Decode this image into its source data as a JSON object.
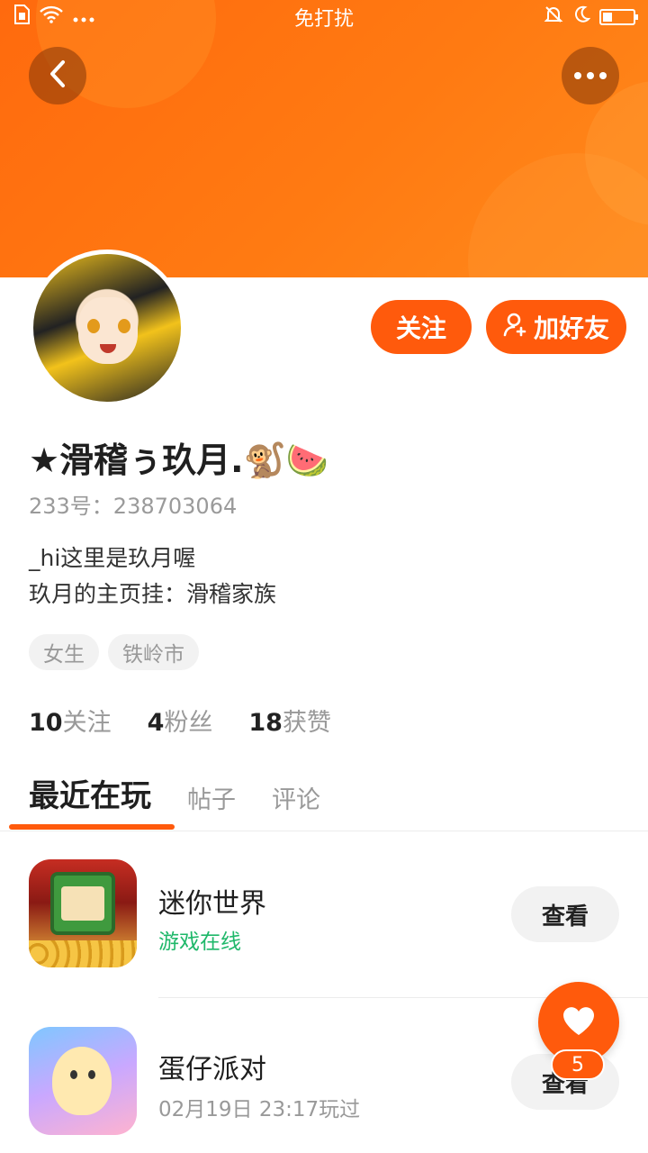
{
  "status_bar": {
    "center_text": "免打扰",
    "left_icons": [
      "sim-icon",
      "wifi-icon",
      "more-dots-icon"
    ],
    "right_icons": [
      "mute-icon",
      "moon-icon",
      "battery-icon"
    ]
  },
  "header": {
    "back_icon": "chevron-left-icon",
    "more_icon": "more-horizontal-icon",
    "accent_color": "#ff6a0e"
  },
  "profile": {
    "nickname": "★滑稽ぅ玖月.🐒🍉",
    "user_id": "233号：238703064",
    "bio_line1": "_hi这里是玖月喔",
    "bio_line2": "玖月的主页挂：滑稽家族",
    "tags": [
      "女生",
      "铁岭市"
    ]
  },
  "actions": {
    "follow_label": "关注",
    "add_friend_label": "加好友"
  },
  "stats": {
    "following_num": "10",
    "following_label": "关注",
    "fans_num": "4",
    "fans_label": "粉丝",
    "likes_num": "18",
    "likes_label": "获赞"
  },
  "tabs": [
    "最近在玩",
    "帖子",
    "评论"
  ],
  "games": [
    {
      "title": "迷你世界",
      "subtitle": "游戏在线",
      "button": "查看"
    },
    {
      "title": "蛋仔派对",
      "subtitle": "02月19日 23:17玩过",
      "button": "查看"
    }
  ],
  "like_fab": {
    "count": "5",
    "icon": "heart-icon"
  }
}
